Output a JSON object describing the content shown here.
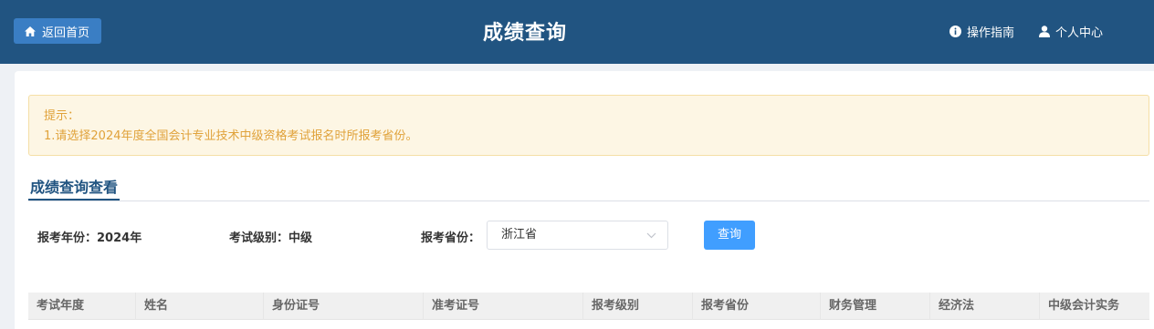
{
  "header": {
    "home_label": "返回首页",
    "title": "成绩查询",
    "guide_label": "操作指南",
    "user_label": "个人中心",
    "bg_color": "#215481"
  },
  "notice": {
    "title": "提示：",
    "line1": "1.请选择2024年度全国会计专业技术中级资格考试报名时所报考省份。"
  },
  "section": {
    "tab_label": "成绩查询查看"
  },
  "form": {
    "year_label": "报考年份：",
    "year_value": "2024年",
    "level_label": "考试级别：",
    "level_value": "中级",
    "province_label": "报考省份：",
    "province_selected": "浙江省",
    "query_button": "查询"
  },
  "table": {
    "columns": [
      "考试年度",
      "姓名",
      "身份证号",
      "准考证号",
      "报考级别",
      "报考省份",
      "财务管理",
      "经济法",
      "中级会计实务"
    ]
  }
}
